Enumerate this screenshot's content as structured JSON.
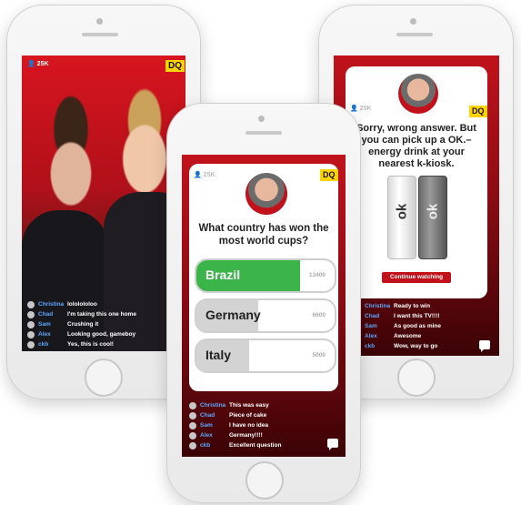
{
  "left_phone": {
    "viewer_count": "25K",
    "logo": "DQ",
    "chat": [
      {
        "name": "Christina",
        "message": "lolololoIoo"
      },
      {
        "name": "Chad",
        "message": "I'm taking this one home"
      },
      {
        "name": "Sam",
        "message": "Crushing it"
      },
      {
        "name": "Alex",
        "message": "Looking good, gameboy"
      },
      {
        "name": "ckb",
        "message": "Yes, this is cool!"
      }
    ]
  },
  "center_phone": {
    "viewer_count": "25K",
    "logo": "DQ",
    "question": "What country has won the most world cups?",
    "answers": [
      {
        "label": "Brazil",
        "count": "13400",
        "fill_fraction": 0.75,
        "color": "#3bb54a"
      },
      {
        "label": "Germany",
        "count": "6600",
        "fill_fraction": 0.45,
        "color": "#d3d3d3"
      },
      {
        "label": "Italy",
        "count": "5000",
        "fill_fraction": 0.38,
        "color": "#d3d3d3"
      }
    ],
    "chat": [
      {
        "name": "Christina",
        "message": "This was easy"
      },
      {
        "name": "Chad",
        "message": "Piece of cake"
      },
      {
        "name": "Sam",
        "message": "I have no idea"
      },
      {
        "name": "Alex",
        "message": "Germany!!!!"
      },
      {
        "name": "ckb",
        "message": "Excellent question"
      }
    ]
  },
  "right_phone": {
    "viewer_count": "25K",
    "logo": "DQ",
    "message": "Sorry, wrong answer. But you can pick up a OK.– energy drink at your nearest k-kiosk.",
    "can_text": "ok",
    "continue_button": "Continue watching",
    "chat": [
      {
        "name": "Christina",
        "message": "Ready to win"
      },
      {
        "name": "Chad",
        "message": "I want this TV!!!!"
      },
      {
        "name": "Sam",
        "message": "As good as mine"
      },
      {
        "name": "Alex",
        "message": "Awesome"
      },
      {
        "name": "ckb",
        "message": "Wow, way to go"
      }
    ]
  },
  "colors": {
    "brand_red": "#c1121c",
    "dark_red": "#3a0306",
    "logo_yellow": "#ffd400",
    "correct_green": "#3bb54a",
    "chat_name_blue": "#5fa8ff"
  }
}
